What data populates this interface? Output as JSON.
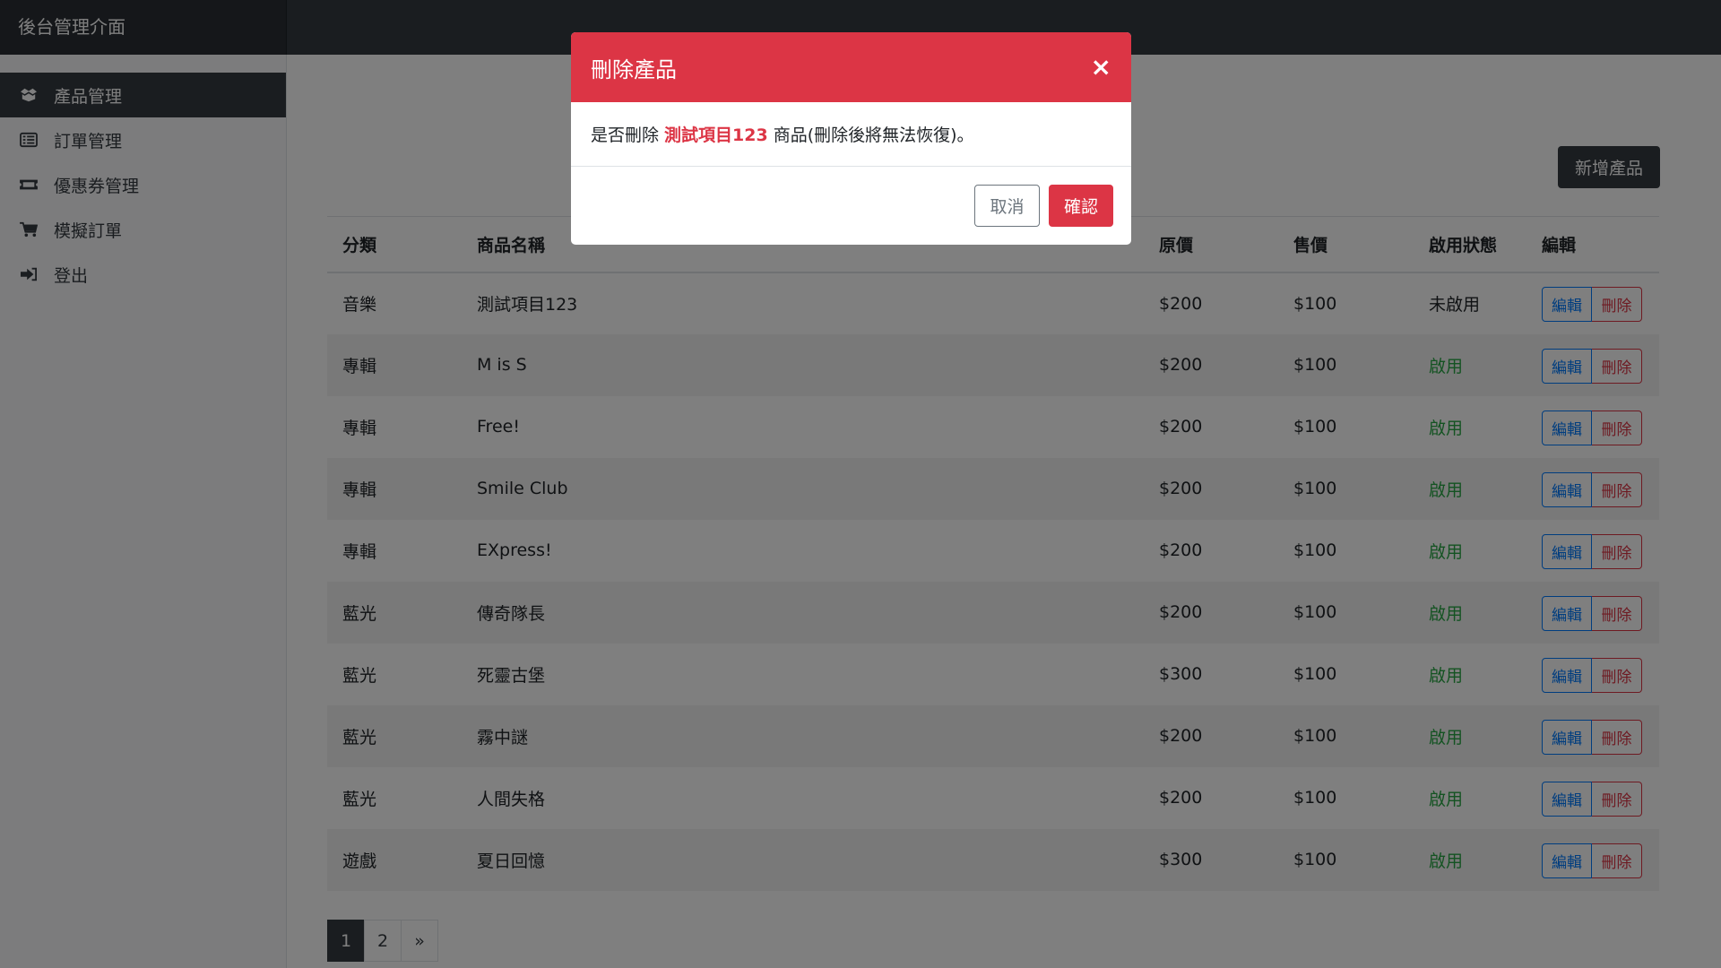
{
  "app": {
    "brand": "後台管理介面"
  },
  "sidebar": {
    "items": [
      {
        "label": "產品管理",
        "icon": "box-open-icon",
        "active": true
      },
      {
        "label": "訂單管理",
        "icon": "list-icon",
        "active": false
      },
      {
        "label": "優惠券管理",
        "icon": "ticket-icon",
        "active": false
      },
      {
        "label": "模擬訂單",
        "icon": "cart-icon",
        "active": false
      },
      {
        "label": "登出",
        "icon": "sign-out-icon",
        "active": false
      }
    ]
  },
  "toolbar": {
    "add_label": "新增產品"
  },
  "table": {
    "headers": [
      "分類",
      "商品名稱",
      "原價",
      "售價",
      "啟用狀態",
      "編輯"
    ],
    "edit_label": "編輯",
    "delete_label": "刪除",
    "rows": [
      {
        "category": "音樂",
        "name": "測試項目123",
        "orig": "$200",
        "sale": "$100",
        "status": "未啟用",
        "enabled": false
      },
      {
        "category": "專輯",
        "name": "M is S",
        "orig": "$200",
        "sale": "$100",
        "status": "啟用",
        "enabled": true
      },
      {
        "category": "專輯",
        "name": "Free!",
        "orig": "$200",
        "sale": "$100",
        "status": "啟用",
        "enabled": true
      },
      {
        "category": "專輯",
        "name": "Smile Club",
        "orig": "$200",
        "sale": "$100",
        "status": "啟用",
        "enabled": true
      },
      {
        "category": "專輯",
        "name": "EXpress!",
        "orig": "$200",
        "sale": "$100",
        "status": "啟用",
        "enabled": true
      },
      {
        "category": "藍光",
        "name": "傳奇隊長",
        "orig": "$200",
        "sale": "$100",
        "status": "啟用",
        "enabled": true
      },
      {
        "category": "藍光",
        "name": "死靈古堡",
        "orig": "$300",
        "sale": "$100",
        "status": "啟用",
        "enabled": true
      },
      {
        "category": "藍光",
        "name": "霧中謎",
        "orig": "$200",
        "sale": "$100",
        "status": "啟用",
        "enabled": true
      },
      {
        "category": "藍光",
        "name": "人間失格",
        "orig": "$200",
        "sale": "$100",
        "status": "啟用",
        "enabled": true
      },
      {
        "category": "遊戲",
        "name": "夏日回憶",
        "orig": "$300",
        "sale": "$100",
        "status": "啟用",
        "enabled": true
      }
    ]
  },
  "pagination": {
    "pages": [
      "1",
      "2"
    ],
    "current": "1",
    "next": "»"
  },
  "modal": {
    "title": "刪除產品",
    "close": "×",
    "body_prefix": "是否刪除",
    "body_item": "測試項目123",
    "body_suffix": "商品(刪除後將無法恢復)。",
    "cancel_label": "取消",
    "confirm_label": "確認"
  },
  "colors": {
    "navbar": "#343a40",
    "danger": "#dc3545",
    "success": "#28a745",
    "primary": "#007bff"
  }
}
